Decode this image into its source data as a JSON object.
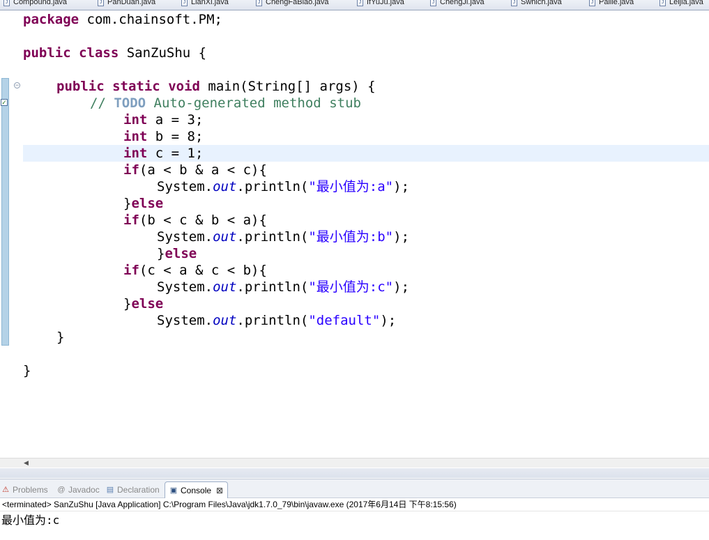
{
  "editor_tabs": [
    {
      "label": "Compound.java"
    },
    {
      "label": "PanDuan.java"
    },
    {
      "label": "LianXi.java"
    },
    {
      "label": "ChengFaBiao.java"
    },
    {
      "label": "IfYuJu.java"
    },
    {
      "label": "ChengJi.java"
    },
    {
      "label": "Swhich.java"
    },
    {
      "label": "Pailie.java"
    },
    {
      "label": "Leijia.java"
    }
  ],
  "code": {
    "line_package": {
      "kw": "package",
      "rest": " com.chainsoft.PM;"
    },
    "line_class": {
      "kw1": "public",
      "kw2": "class",
      "rest": " SanZuShu {"
    },
    "line_main": {
      "kw1": "public",
      "kw2": "static",
      "kw3": "void",
      "rest": " main(String[] args) {"
    },
    "line_todo": {
      "prefix": "// ",
      "todo": "TODO",
      "rest": " Auto-generated method stub"
    },
    "line_a": {
      "kw": "int",
      "rest": " a = 3;"
    },
    "line_b": {
      "kw": "int",
      "rest": " b = 8;"
    },
    "line_c": {
      "kw": "int",
      "rest": " c = 1;"
    },
    "line_if1": {
      "kw": "if",
      "rest": "(a < b & a < c){"
    },
    "line_print1": {
      "pre": "System.",
      "field": "out",
      "mid": ".println(",
      "str": "\"最小值为:a\"",
      "post": ");"
    },
    "line_else1": {
      "pre": "}",
      "kw": "else"
    },
    "line_if2": {
      "kw": "if",
      "rest": "(b < c & b < a){"
    },
    "line_print2": {
      "pre": "System.",
      "field": "out",
      "mid": ".println(",
      "str": "\"最小值为:b\"",
      "post": ");"
    },
    "line_else2": {
      "pre": "}",
      "kw": "else"
    },
    "line_if3": {
      "kw": "if",
      "rest": "(c < a & c < b){"
    },
    "line_print3": {
      "pre": "System.",
      "field": "out",
      "mid": ".println(",
      "str": "\"最小值为:c\"",
      "post": ");"
    },
    "line_else3": {
      "pre": "}",
      "kw": "else"
    },
    "line_print4": {
      "pre": "System.",
      "field": "out",
      "mid": ".println(",
      "str": "\"default\"",
      "post": ");"
    },
    "line_close_main": "}",
    "line_close_class": "}"
  },
  "view_tabs": [
    {
      "label": "Problems",
      "icon": "problems-icon"
    },
    {
      "label": "Javadoc",
      "icon": "@"
    },
    {
      "label": "Declaration",
      "icon": "declaration-icon"
    },
    {
      "label": "Console",
      "icon": "console-icon",
      "close": "⊠"
    }
  ],
  "console": {
    "status": "<terminated> SanZuShu [Java Application] C:\\Program Files\\Java\\jdk1.7.0_79\\bin\\javaw.exe (2017年6月14日 下午8:15:56)",
    "output_label": "最小值为",
    "output_value": ":c"
  },
  "colors": {
    "keyword": "#7f0055",
    "comment": "#3f7f5f",
    "string": "#2a00ff",
    "field": "#0000c0",
    "current_line": "#e8f2fe"
  }
}
